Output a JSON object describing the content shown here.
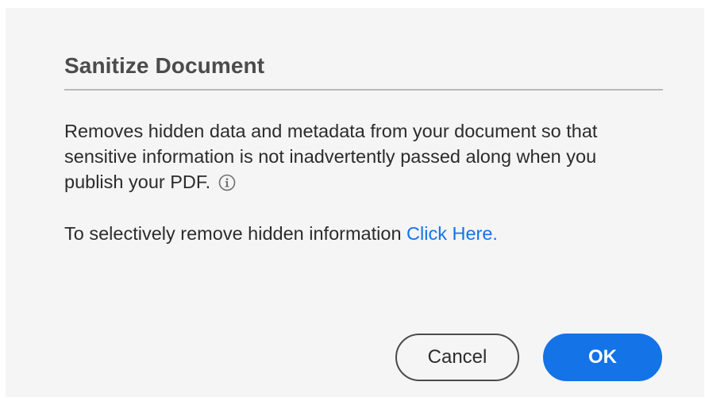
{
  "dialog": {
    "title": "Sanitize Document",
    "description": "Removes hidden data and metadata from your document so that sensitive information is not inadvertently passed along when you publish your PDF.",
    "info_icon": "info-circle-icon",
    "selective_text": "To selectively remove hidden information ",
    "selective_link": "Click Here.",
    "cancel_label": "Cancel",
    "ok_label": "OK"
  },
  "colors": {
    "accent": "#1473e6",
    "background": "#f5f5f5",
    "title": "#4b4b4b",
    "body_text": "#2c2c2c"
  }
}
